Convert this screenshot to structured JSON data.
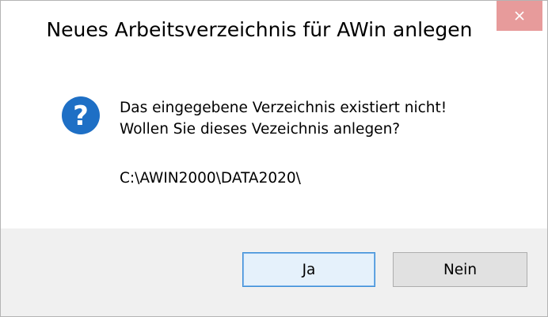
{
  "dialog": {
    "title": "Neues Arbeitsverzeichnis für AWin anlegen",
    "message_line1": "Das eingegebene Verzeichnis existiert nicht!",
    "message_line2": "Wollen Sie dieses Vezeichnis anlegen?",
    "path": "C:\\AWIN2000\\DATA2020\\",
    "icon": "question-icon",
    "buttons": {
      "yes_label": "Ja",
      "no_label": "Nein"
    }
  },
  "colors": {
    "close_button_bg": "#e79b9b",
    "icon_blue": "#1e6fc5",
    "footer_bg": "#f0f0f0",
    "default_button_border": "#3c8fd8"
  }
}
